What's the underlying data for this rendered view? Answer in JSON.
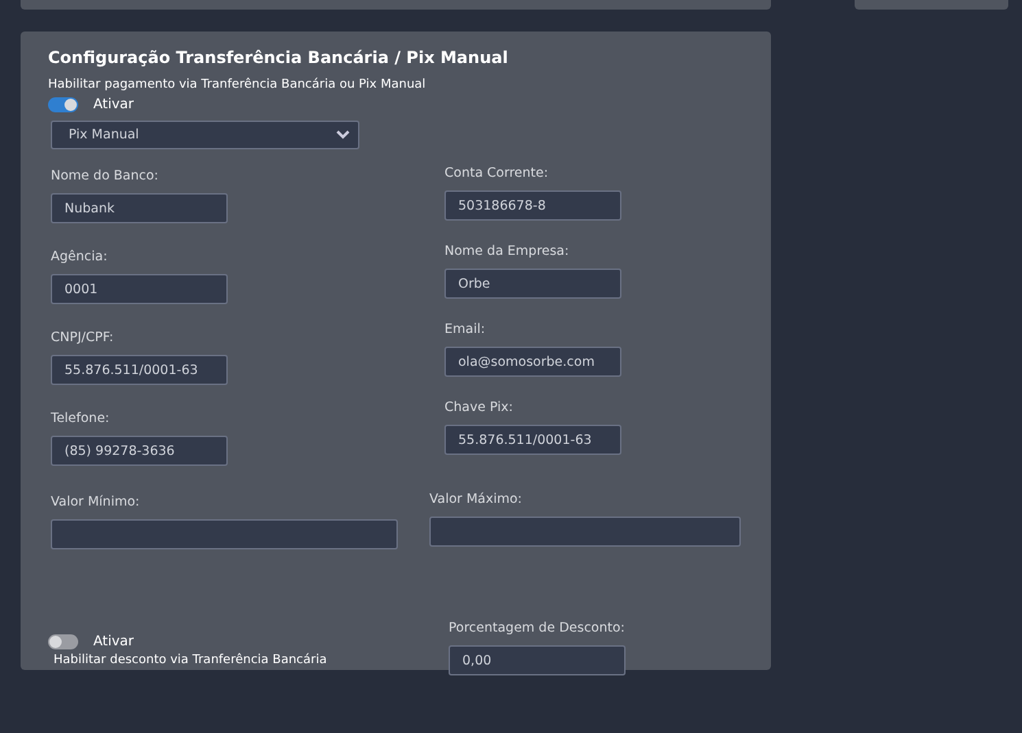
{
  "section": {
    "title": "Configuração Transferência Bancária / Pix Manual",
    "subtitle": "Habilitar pagamento via Tranferência Bancária ou Pix Manual",
    "payment_toggle": {
      "label": "Ativar",
      "on": true
    },
    "method_select": {
      "value": "Pix Manual"
    },
    "left_fields": [
      {
        "label": "Nome do Banco:",
        "value": "Nubank"
      },
      {
        "label": "Agência:",
        "value": "0001"
      },
      {
        "label": "CNPJ/CPF:",
        "value": "55.876.511/0001-63"
      },
      {
        "label": "Telefone:",
        "value": "(85) 99278-3636"
      }
    ],
    "right_fields": [
      {
        "label": "Conta Corrente:",
        "value": "503186678-8"
      },
      {
        "label": "Nome da Empresa:",
        "value": "Orbe"
      },
      {
        "label": "Email:",
        "value": "ola@somosorbe.com"
      },
      {
        "label": "Chave Pix:",
        "value": "55.876.511/0001-63"
      }
    ],
    "limit_fields": [
      {
        "label": "Valor Mínimo:"
      },
      {
        "label": "Valor Máximo:"
      }
    ],
    "discount_toggle": {
      "label": "Ativar",
      "on": false,
      "description": "Habilitar desconto via Tranferência Bancária"
    },
    "discount_field": {
      "label": "Porcentagem de Desconto:",
      "value": "0,00"
    }
  }
}
